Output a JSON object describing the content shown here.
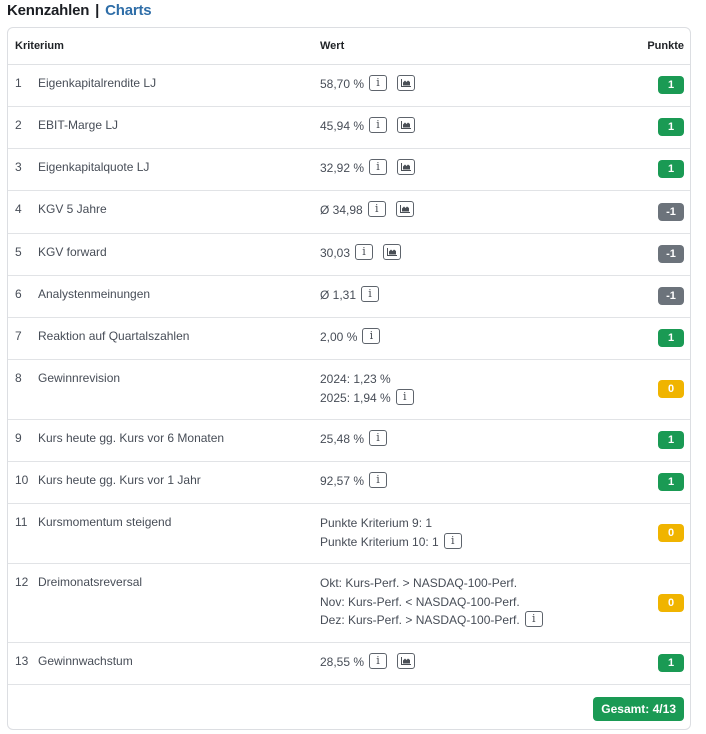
{
  "heading": {
    "title": "Kennzahlen",
    "separator": "|",
    "link": "Charts"
  },
  "table": {
    "columns": {
      "criterion": "Kriterium",
      "value": "Wert",
      "points": "Punkte"
    },
    "rows": [
      {
        "num": "1",
        "label": "Eigenkapitalrendite LJ",
        "lines": [
          "58,70 %"
        ],
        "info": true,
        "chart": true,
        "points": "1",
        "status": "positive"
      },
      {
        "num": "2",
        "label": "EBIT-Marge LJ",
        "lines": [
          "45,94 %"
        ],
        "info": true,
        "chart": true,
        "points": "1",
        "status": "positive"
      },
      {
        "num": "3",
        "label": "Eigenkapitalquote LJ",
        "lines": [
          "32,92 %"
        ],
        "info": true,
        "chart": true,
        "points": "1",
        "status": "positive"
      },
      {
        "num": "4",
        "label": "KGV 5 Jahre",
        "lines": [
          "Ø 34,98"
        ],
        "info": true,
        "chart": true,
        "points": "-1",
        "status": "negative"
      },
      {
        "num": "5",
        "label": "KGV forward",
        "lines": [
          "30,03"
        ],
        "info": true,
        "chart": true,
        "points": "-1",
        "status": "negative"
      },
      {
        "num": "6",
        "label": "Analystenmeinungen",
        "lines": [
          "Ø 1,31"
        ],
        "info": true,
        "chart": false,
        "points": "-1",
        "status": "negative"
      },
      {
        "num": "7",
        "label": "Reaktion auf Quartalszahlen",
        "lines": [
          "2,00 %"
        ],
        "info": true,
        "chart": false,
        "points": "1",
        "status": "positive"
      },
      {
        "num": "8",
        "label": "Gewinnrevision",
        "lines": [
          "2024: 1,23 %",
          "2025: 1,94 %"
        ],
        "info": true,
        "chart": false,
        "points": "0",
        "status": "neutral"
      },
      {
        "num": "9",
        "label": "Kurs heute gg. Kurs vor 6 Monaten",
        "lines": [
          "25,48 %"
        ],
        "info": true,
        "chart": false,
        "points": "1",
        "status": "positive"
      },
      {
        "num": "10",
        "label": "Kurs heute gg. Kurs vor 1 Jahr",
        "lines": [
          "92,57 %"
        ],
        "info": true,
        "chart": false,
        "points": "1",
        "status": "positive"
      },
      {
        "num": "11",
        "label": "Kursmomentum steigend",
        "lines": [
          "Punkte Kriterium 9: 1",
          "Punkte Kriterium 10: 1"
        ],
        "info": true,
        "chart": false,
        "points": "0",
        "status": "neutral"
      },
      {
        "num": "12",
        "label": "Dreimonatsreversal",
        "lines": [
          "Okt: Kurs-Perf. > NASDAQ-100-Perf.",
          "Nov: Kurs-Perf. < NASDAQ-100-Perf.",
          "Dez: Kurs-Perf. > NASDAQ-100-Perf."
        ],
        "info": true,
        "chart": false,
        "points": "0",
        "status": "neutral"
      },
      {
        "num": "13",
        "label": "Gewinnwachstum",
        "lines": [
          "28,55 %"
        ],
        "info": true,
        "chart": true,
        "points": "1",
        "status": "positive"
      }
    ],
    "total": "Gesamt: 4/13"
  },
  "icons": {
    "info": "i",
    "chart": "area-chart-icon"
  },
  "colors": {
    "positive": "#1a9a54",
    "negative": "#6c737b",
    "neutral": "#f0b400",
    "link": "#2f6ea8"
  }
}
